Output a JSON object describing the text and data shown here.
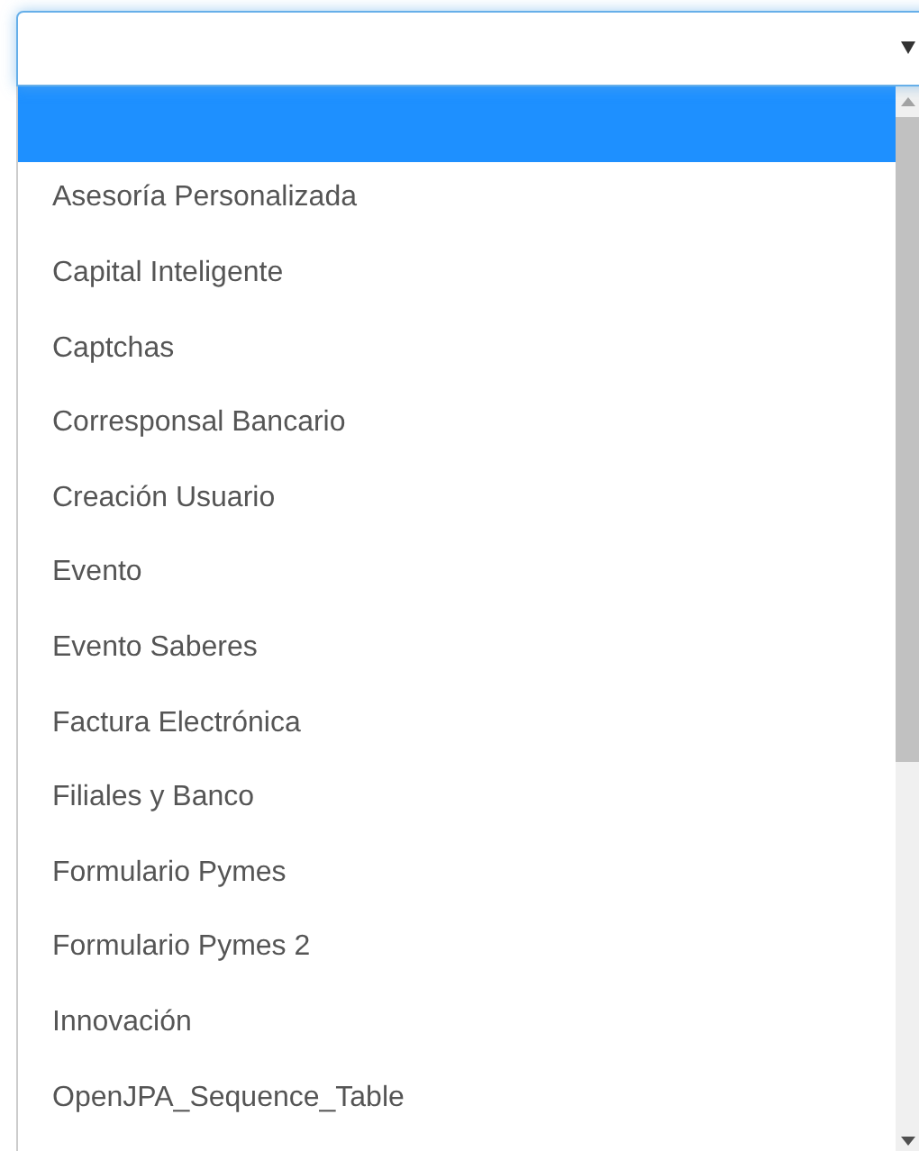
{
  "select": {
    "expanded": true
  },
  "options": [
    {
      "selected": true
    },
    {
      "label": "Asesoría Personalizada",
      "selected": false
    },
    {
      "label": "Capital Inteligente",
      "selected": false
    },
    {
      "label": "Captchas",
      "selected": false
    },
    {
      "label": "Corresponsal Bancario",
      "selected": false
    },
    {
      "label": "Creación Usuario",
      "selected": false
    },
    {
      "label": "Evento",
      "selected": false
    },
    {
      "label": "Evento Saberes",
      "selected": false
    },
    {
      "label": "Factura Electrónica",
      "selected": false
    },
    {
      "label": "Filiales y Banco",
      "selected": false
    },
    {
      "label": "Formulario Pymes",
      "selected": false
    },
    {
      "label": "Formulario Pymes 2",
      "selected": false
    },
    {
      "label": "Innovación",
      "selected": false
    },
    {
      "label": "OpenJPA_Sequence_Table",
      "selected": false
    }
  ]
}
